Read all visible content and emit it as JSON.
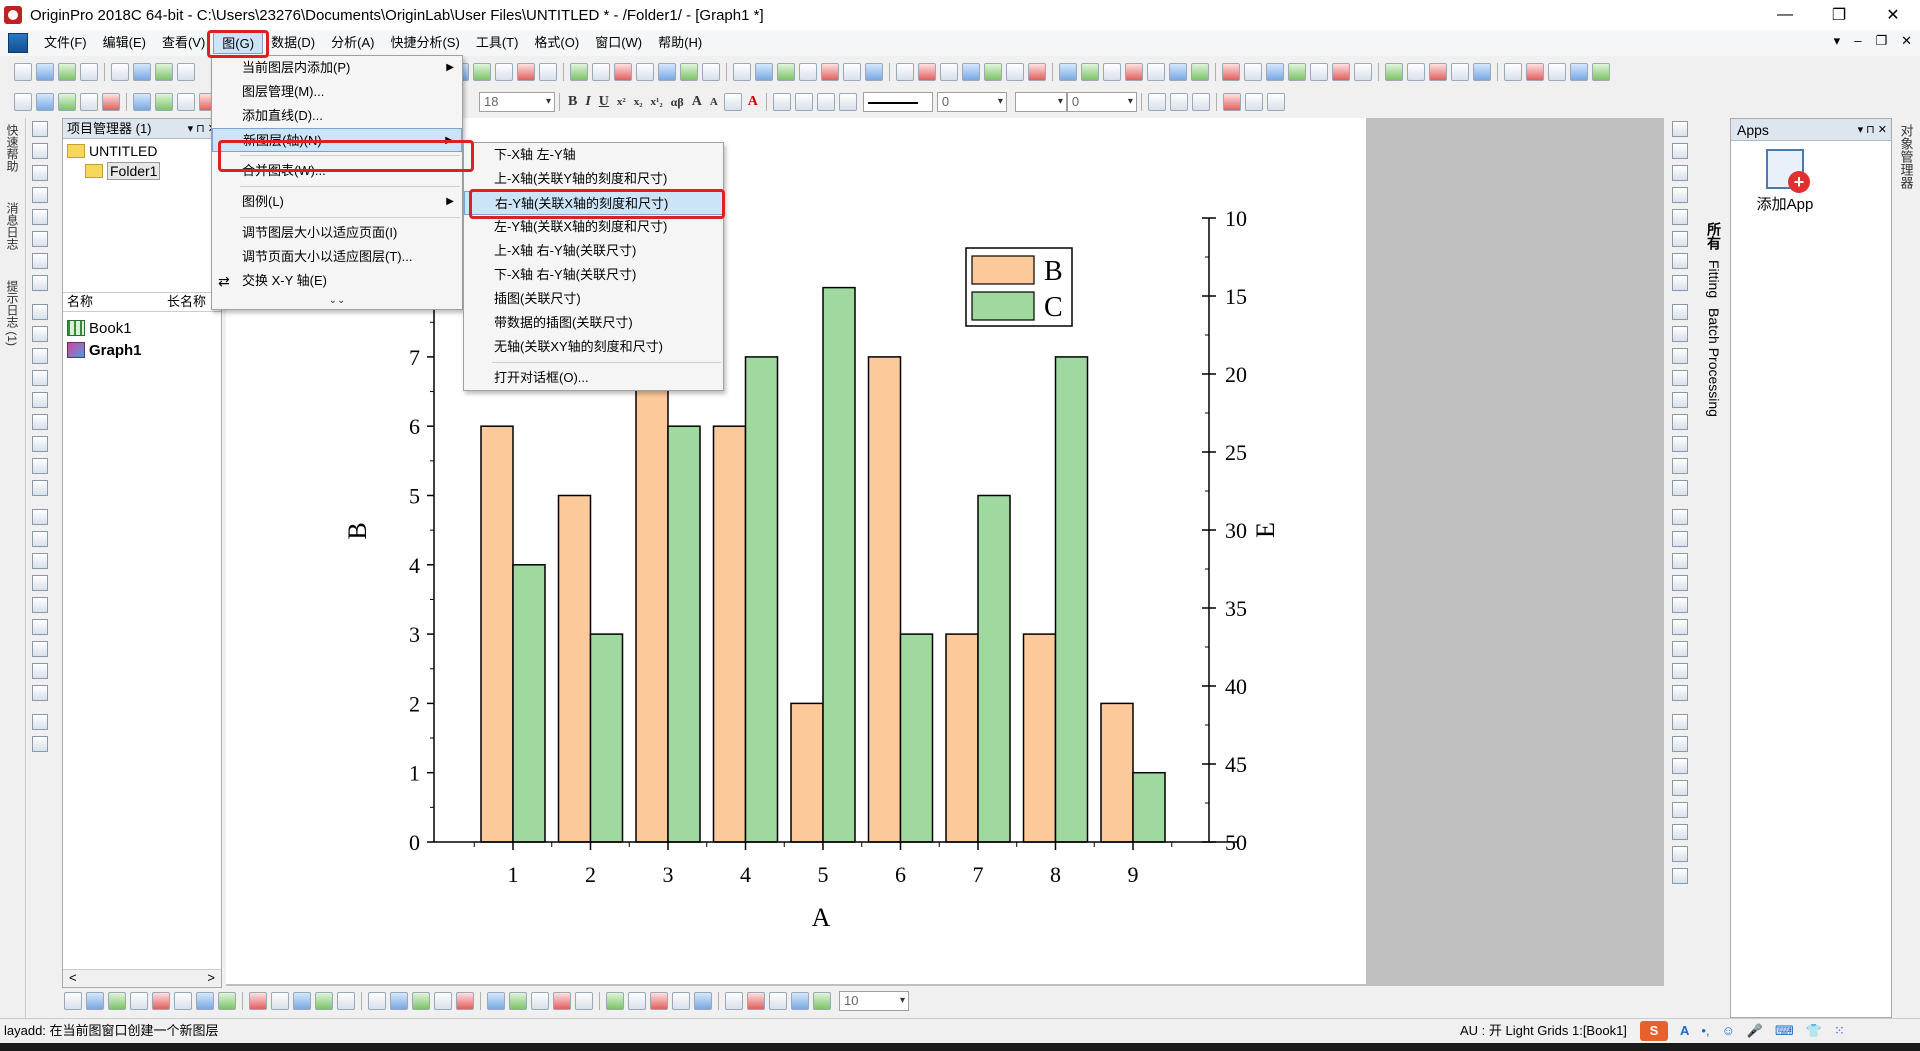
{
  "window": {
    "title": "OriginPro 2018C 64-bit - C:\\Users\\23276\\Documents\\OriginLab\\User Files\\UNTITLED * - /Folder1/ - [Graph1 *]",
    "min": "—",
    "max": "❐",
    "close": "✕"
  },
  "menubar": {
    "items": [
      "文件(F)",
      "编辑(E)",
      "查看(V)",
      "图(G)",
      "数据(D)",
      "分析(A)",
      "快捷分析(S)",
      "工具(T)",
      "格式(O)",
      "窗口(W)",
      "帮助(H)"
    ],
    "active_index": 3,
    "ctrls": [
      "▾",
      "–",
      "❐",
      "✕"
    ]
  },
  "format_toolbar": {
    "font_size": "18",
    "line_size": "0",
    "fill_value": "0"
  },
  "left_strip": {
    "tabs": [
      "快速帮助",
      "消息日志",
      "提示日志 (1)"
    ]
  },
  "project_manager": {
    "title": "项目管理器 (1)",
    "header_ctrls": "▾ ⊓ ✕",
    "root": "UNTITLED",
    "folder": "Folder1",
    "columns": [
      "名称",
      "长名称"
    ],
    "files": [
      {
        "name": "Book1",
        "type": "book"
      },
      {
        "name": "Graph1",
        "type": "graph"
      }
    ],
    "scroll_left": "<",
    "scroll_right": ">"
  },
  "graph_menu": {
    "items": [
      {
        "label": "当前图层内添加(P)",
        "submenu": true
      },
      {
        "label": "图层管理(M)...",
        "submenu": false
      },
      {
        "label": "添加直线(D)...",
        "submenu": false
      },
      {
        "label": "新图层(轴)(N)",
        "submenu": true,
        "highlight": true
      },
      {
        "label": "合并图表(W)...",
        "submenu": false
      },
      {
        "label": "图例(L)",
        "submenu": true
      },
      {
        "label": "调节图层大小以适应页面(I)",
        "submenu": false
      },
      {
        "label": "调节页面大小以适应图层(T)...",
        "submenu": false
      },
      {
        "label": "交换 X-Y 轴(E)",
        "submenu": false
      }
    ],
    "more": "⌄⌄",
    "arrow": "▶",
    "swap_icon": "⇄"
  },
  "new_layer_submenu": {
    "items": [
      "下-X轴 左-Y轴",
      "上-X轴(关联Y轴的刻度和尺寸)",
      "右-Y轴(关联X轴的刻度和尺寸)",
      "左-Y轴(关联X轴的刻度和尺寸)",
      "上-X轴 右-Y轴(关联尺寸)",
      "下-X轴 右-Y轴(关联尺寸)",
      "插图(关联尺寸)",
      "带数据的插图(关联尺寸)",
      "无轴(关联XY轴的刻度和尺寸)",
      "打开对话框(O)..."
    ],
    "highlight_index": 2
  },
  "chart_data": {
    "type": "bar",
    "categories": [
      "1",
      "2",
      "3",
      "4",
      "5",
      "6",
      "7",
      "8",
      "9"
    ],
    "series": [
      {
        "name": "B",
        "values": [
          6,
          5,
          7,
          6,
          2,
          7,
          3,
          3,
          2
        ],
        "color": "#fbc99a"
      },
      {
        "name": "C",
        "values": [
          4,
          3,
          6,
          7,
          8,
          3,
          5,
          7,
          1
        ],
        "color": "#a0d9a0"
      }
    ],
    "xlabel": "A",
    "ylabel": "B",
    "ylim": [
      0,
      9
    ],
    "y_ticks": [
      "0",
      "1",
      "2",
      "3",
      "4",
      "5",
      "6",
      "7"
    ],
    "right_axis": {
      "label": "E",
      "range": [
        10,
        50
      ],
      "inverted": true,
      "ticks": [
        "10",
        "15",
        "20",
        "25",
        "30",
        "35",
        "40",
        "45",
        "50"
      ]
    },
    "legend_position": "top-center",
    "grid": false
  },
  "apps_panel": {
    "title": "Apps",
    "header_ctrls": "▾ ⊓ ✕",
    "tabs": [
      "所有",
      "Fitting",
      "Batch Processing"
    ],
    "add_app_label": "添加App",
    "plus": "+"
  },
  "far_right": {
    "tabs": [
      "对象管理器"
    ]
  },
  "bottom_toolbar": {
    "zoom_value": "10"
  },
  "statusbar": {
    "hint": "layadd: 在当前图窗口创建一个新图层",
    "right": "AU : 开  Light Grids  1:[Book1]",
    "ime_logo": "S",
    "ime_items": [
      "A",
      "•,",
      "☺",
      "🎤",
      "⌨",
      "👕",
      "⁙"
    ]
  },
  "colors": {
    "orange_bar": "#fbc99a",
    "green_bar": "#a0d9a0",
    "highlight_box": "#e02020",
    "menu_highlight": "#cce4f7"
  }
}
